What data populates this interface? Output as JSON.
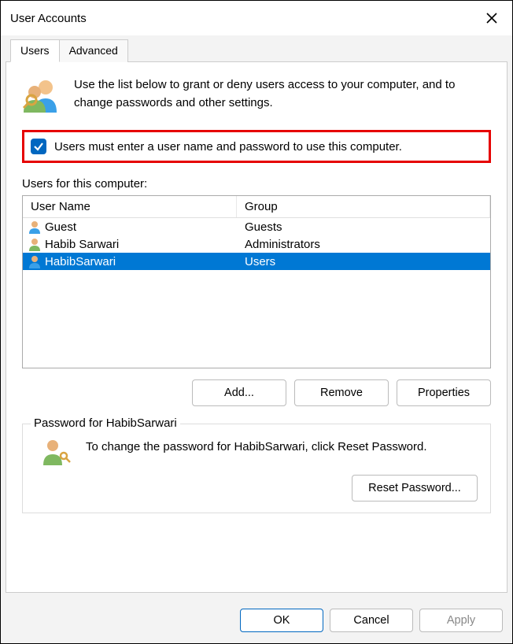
{
  "window": {
    "title": "User Accounts"
  },
  "tabs": {
    "users": "Users",
    "advanced": "Advanced"
  },
  "intro": "Use the list below to grant or deny users access to your computer, and to change passwords and other settings.",
  "checkbox_label": "Users must enter a user name and password to use this computer.",
  "users_for_label": "Users for this computer:",
  "columns": {
    "user": "User Name",
    "group": "Group"
  },
  "rows": [
    {
      "user": "Guest",
      "group": "Guests"
    },
    {
      "user": "Habib Sarwari",
      "group": "Administrators"
    },
    {
      "user": "HabibSarwari",
      "group": "Users"
    }
  ],
  "buttons": {
    "add": "Add...",
    "remove": "Remove",
    "properties": "Properties",
    "reset_pw": "Reset Password...",
    "ok": "OK",
    "cancel": "Cancel",
    "apply": "Apply"
  },
  "password_box": {
    "title": "Password for HabibSarwari",
    "text": "To change the password for HabibSarwari, click Reset Password."
  }
}
